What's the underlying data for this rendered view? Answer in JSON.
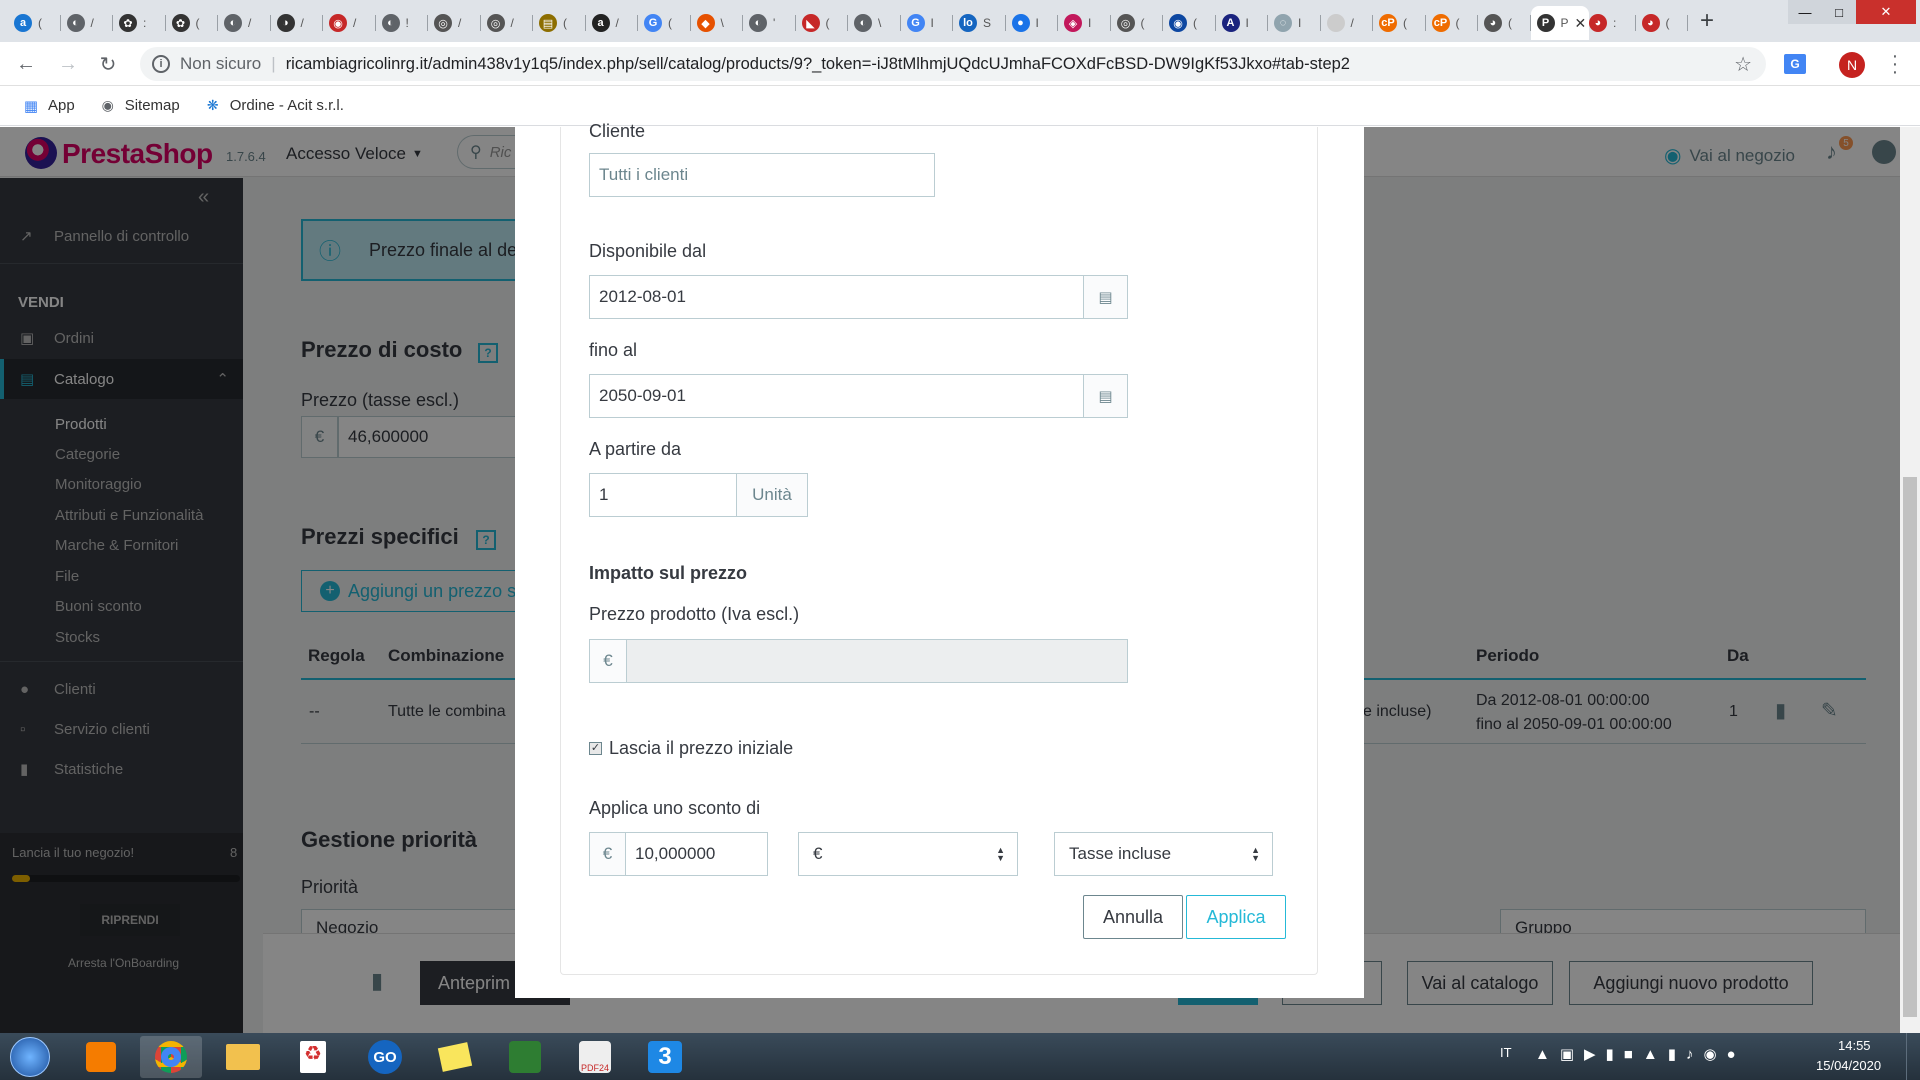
{
  "browser": {
    "tabs": [
      {
        "icon": "a",
        "color": "#1976d2"
      },
      {
        "icon": "◐",
        "color": "#5f6368"
      },
      {
        "icon": "✿",
        "color": "#333"
      },
      {
        "icon": "✿",
        "color": "#333"
      },
      {
        "icon": "◐",
        "color": "#5f6368"
      },
      {
        "icon": "◑",
        "color": "#333"
      },
      {
        "icon": "◉",
        "color": "#c62828"
      },
      {
        "icon": "◐",
        "color": "#5f6368"
      },
      {
        "icon": "◎",
        "color": "#555"
      },
      {
        "icon": "◎",
        "color": "#555"
      },
      {
        "icon": "▤",
        "color": "#8d6e00"
      },
      {
        "icon": "a",
        "color": "#222"
      },
      {
        "icon": "G",
        "color": "#4285f4"
      },
      {
        "icon": "◆",
        "color": "#e65100"
      },
      {
        "icon": "◐",
        "color": "#5f6368"
      },
      {
        "icon": "◣",
        "color": "#c62828"
      },
      {
        "icon": "◐",
        "color": "#5f6368"
      },
      {
        "icon": "G",
        "color": "#4285f4"
      },
      {
        "icon": "lo",
        "color": "#1565c0"
      },
      {
        "icon": "●",
        "color": "#1a73e8"
      },
      {
        "icon": "◈",
        "color": "#c2185b"
      },
      {
        "icon": "◎",
        "color": "#555"
      },
      {
        "icon": "◉",
        "color": "#0d47a1"
      },
      {
        "icon": "A",
        "color": "#1a237e"
      },
      {
        "icon": "◌",
        "color": "#90a4ae"
      },
      {
        "icon": "",
        "color": "#ccc"
      },
      {
        "icon": "cP",
        "color": "#ef6c00"
      },
      {
        "icon": "cP",
        "color": "#ef6c00"
      },
      {
        "icon": "◕",
        "color": "#555"
      },
      {
        "icon": "P",
        "color": "#333"
      },
      {
        "icon": "◕",
        "color": "#c62828"
      },
      {
        "icon": "◕",
        "color": "#c62828"
      }
    ],
    "active_tab_label": "P",
    "tab_texts": [
      "(",
      "/",
      ":",
      "(",
      "/",
      "/",
      "/",
      "!",
      "/",
      "/",
      "(",
      "/",
      "(",
      "\\",
      "'",
      "(",
      "\\",
      "I",
      "S",
      "I",
      "I",
      "(",
      "(",
      "I",
      "I",
      "/",
      "(",
      "(",
      "(",
      "P",
      ":",
      "("
    ],
    "url_security": "Non sicuro",
    "url": "ricambiagricolinrg.it/admin438v1y1q5/index.php/sell/catalog/products/9?_token=-iJ8tMlhmjUQdcUJmhaFCOXdFcBSD-DW9IgKf53Jkxo#tab-step2",
    "profile_initial": "N",
    "bookmarks": [
      {
        "label": "App"
      },
      {
        "label": "Sitemap"
      },
      {
        "label": "Ordine - Acit s.r.l."
      }
    ]
  },
  "header": {
    "logo": "PrestaShop",
    "version": "1.7.6.4",
    "quick_access": "Accesso Veloce",
    "search_placeholder": "Ric",
    "shop_link": "Vai al negozio",
    "notifications_count": "5"
  },
  "sidebar": {
    "dashboard": "Pannello di controllo",
    "section_sell": "VENDI",
    "orders": "Ordini",
    "catalog": "Catalogo",
    "catalog_sub": [
      "Prodotti",
      "Categorie",
      "Monitoraggio",
      "Attributi e Funzionalità",
      "Marche & Fornitori",
      "File",
      "Buoni sconto",
      "Stocks"
    ],
    "customers": "Clienti",
    "customer_service": "Servizio clienti",
    "stats": "Statistiche",
    "onboarding_text": "Lancia il tuo negozio!",
    "onboarding_progress_text": "8",
    "onboarding_progress": 0.08,
    "resume_btn": "RIPRENDI",
    "stop_onboarding": "Arresta l'OnBoarding"
  },
  "content": {
    "info_text": "Prezzo finale al de",
    "cost_title": "Prezzo di costo",
    "cost_label": "Prezzo (tasse escl.)",
    "cost_currency": "€",
    "cost_value": "46,600000",
    "specific_title": "Prezzi specifici",
    "add_specific_btn": "Aggiungi un prezzo s",
    "table_headers": [
      "Regola",
      "Combinazione",
      "Periodo",
      "Da"
    ],
    "row": {
      "rule": "--",
      "combination": "Tutte le combina",
      "impact": "e incluse)",
      "period_from": "Da 2012-08-01 00:00:00",
      "period_to": "fino al 2050-09-01 00:00:00",
      "from_qty": "1"
    },
    "priority_title": "Gestione priorità",
    "priority_label": "Priorità",
    "priority_select1": "Negozio",
    "priority_select2": "Gruppo",
    "footer_preview": "Anteprim",
    "footer_catalog": "Vai al catalogo",
    "footer_new": "Aggiungi nuovo prodotto"
  },
  "modal": {
    "customer_label": "Cliente",
    "customer_placeholder": "Tutti i clienti",
    "from_label": "Disponibile dal",
    "from_value": "2012-08-01",
    "to_label": "fino al",
    "to_value": "2050-09-01",
    "qty_label": "A partire da",
    "qty_value": "1",
    "qty_unit": "Unità",
    "impact_title": "Impatto sul prezzo",
    "price_label": "Prezzo prodotto (Iva escl.)",
    "price_currency": "€",
    "price_value": "",
    "keep_initial_label": "Lascia il prezzo iniziale",
    "keep_initial_checked": true,
    "discount_label": "Applica uno sconto di",
    "discount_currency": "€",
    "discount_value": "10,000000",
    "discount_type": "€",
    "tax_option": "Tasse incluse",
    "cancel_btn": "Annulla",
    "apply_btn": "Applica"
  },
  "taskbar": {
    "language": "IT",
    "time": "14:55",
    "date": "15/04/2020"
  },
  "colors": {
    "accent": "#25b9d7",
    "sidebar_bg": "#363a41",
    "sidebar_active": "#25b9d7",
    "modal_btn_border": "#6c868e"
  }
}
